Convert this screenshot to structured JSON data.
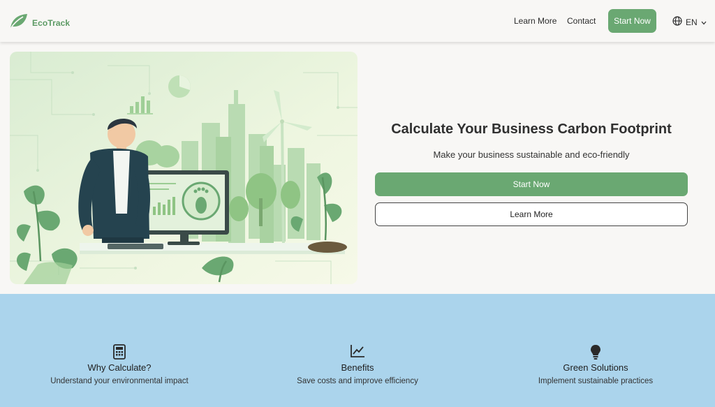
{
  "header": {
    "brand": "EcoTrack",
    "nav": {
      "learn_more": "Learn More",
      "contact": "Contact",
      "start_now": "Start Now"
    },
    "language": "EN"
  },
  "hero": {
    "title": "Calculate Your Business Carbon Footprint",
    "subtitle": "Make your business sustainable and eco-friendly",
    "primary_button": "Start Now",
    "secondary_button": "Learn More"
  },
  "features": [
    {
      "icon": "calculator-icon",
      "title": "Why Calculate?",
      "description": "Understand your environmental impact"
    },
    {
      "icon": "chart-line-icon",
      "title": "Benefits",
      "description": "Save costs and improve efficiency"
    },
    {
      "icon": "lightbulb-icon",
      "title": "Green Solutions",
      "description": "Implement sustainable practices"
    }
  ],
  "colors": {
    "brand_green": "#6aa872",
    "logo_green": "#5c9a64",
    "background": "#f8f7f5",
    "features_bg": "#abd4ec"
  }
}
